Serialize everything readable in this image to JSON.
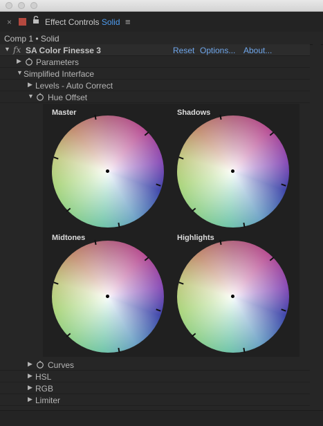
{
  "window": {
    "controls": [
      "close-traffic-light",
      "minimize-traffic-light",
      "zoom-traffic-light"
    ]
  },
  "panel": {
    "title": "Effect Controls",
    "layer_name": "Solid",
    "comp_breadcrumb": "Comp 1 • Solid",
    "close_glyph": "×",
    "menu_glyph": "≡",
    "swatch_color": "#b4493f",
    "accent_color": "#4d9bef"
  },
  "effect": {
    "fx_label": "fx",
    "name": "SA Color Finesse 3",
    "reset": "Reset",
    "options": "Options...",
    "about": "About..."
  },
  "tree": {
    "parameters": "Parameters",
    "simplified_interface": "Simplified Interface",
    "levels_auto_correct": "Levels - Auto Correct",
    "hue_offset": "Hue Offset",
    "curves": "Curves",
    "hsl": "HSL",
    "rgb": "RGB",
    "limiter": "Limiter"
  },
  "wheels": [
    {
      "label": "Master"
    },
    {
      "label": "Shadows"
    },
    {
      "label": "Midtones"
    },
    {
      "label": "Highlights"
    }
  ]
}
